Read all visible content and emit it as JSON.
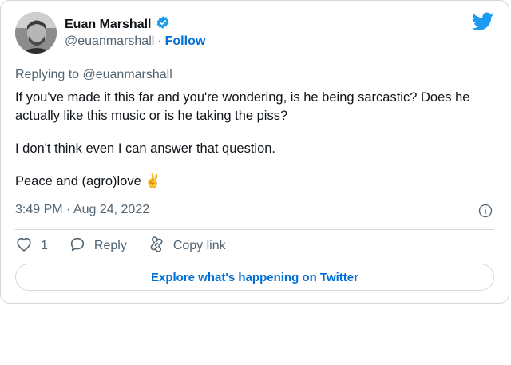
{
  "author": {
    "name": "Euan Marshall",
    "handle": "@euanmarshall",
    "separator": "·",
    "follow_label": "Follow"
  },
  "replying_to": "Replying to @euanmarshall",
  "tweet": {
    "paragraph_1": "If you've made it this far and you're wondering, is he being sarcastic? Does he actually like this music or is he taking the piss?",
    "paragraph_2": "I don't think even I can answer that question.",
    "paragraph_3": "Peace and (agro)love ✌️"
  },
  "timestamp": "3:49 PM · Aug 24, 2022",
  "actions": {
    "like_count": "1",
    "reply_label": "Reply",
    "copy_link_label": "Copy link"
  },
  "explore_label": "Explore what's happening on Twitter",
  "icons": {
    "verified": "verified-badge-icon",
    "brand": "twitter-bird-icon",
    "info": "info-icon",
    "like": "heart-icon",
    "reply": "speech-bubble-icon",
    "copy_link": "link-icon"
  },
  "colors": {
    "accent": "#1d9bf0",
    "link": "#006fd6",
    "muted": "#536471",
    "border": "#cfd9de"
  }
}
